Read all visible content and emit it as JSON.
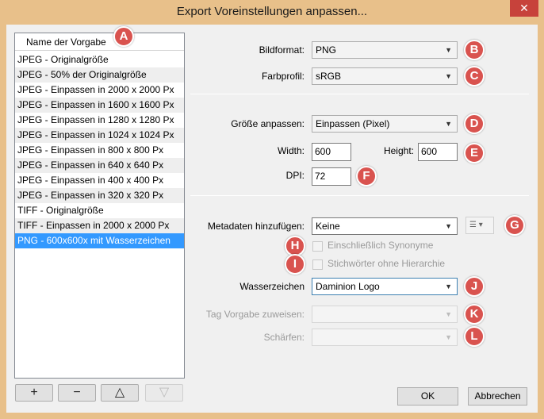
{
  "window": {
    "title": "Export Voreinstellungen anpassen...",
    "close_label": "✕",
    "accent": "#e8c08a",
    "close_color": "#c7423b"
  },
  "preset_list": {
    "header": "Name der Vorgabe",
    "items": [
      {
        "label": "JPEG - Originalgröße",
        "selected": false
      },
      {
        "label": "JPEG - 50% der Originalgröße",
        "selected": false
      },
      {
        "label": "JPEG - Einpassen in 2000 x 2000 Px",
        "selected": false
      },
      {
        "label": "JPEG - Einpassen in 1600 x 1600 Px",
        "selected": false
      },
      {
        "label": "JPEG - Einpassen in 1280 x 1280 Px",
        "selected": false
      },
      {
        "label": "JPEG - Einpassen in 1024 x 1024 Px",
        "selected": false
      },
      {
        "label": "JPEG - Einpassen in 800 x 800 Px",
        "selected": false
      },
      {
        "label": "JPEG - Einpassen in 640 x 640 Px",
        "selected": false
      },
      {
        "label": "JPEG - Einpassen in 400 x 400 Px",
        "selected": false
      },
      {
        "label": "JPEG - Einpassen in 320 x 320 Px",
        "selected": false
      },
      {
        "label": "TIFF - Originalgröße",
        "selected": false
      },
      {
        "label": "TIFF - Einpassen in 2000 x 2000 Px",
        "selected": false
      },
      {
        "label": "PNG - 600x600x mit Wasserzeichen",
        "selected": true
      }
    ],
    "selection_color": "#3399ff",
    "buttons": {
      "add": "+",
      "remove": "−",
      "up": "△",
      "down": "▽"
    }
  },
  "form": {
    "bildformat": {
      "label": "Bildformat:",
      "value": "PNG"
    },
    "farbprofil": {
      "label": "Farbprofil:",
      "value": "sRGB"
    },
    "groesse": {
      "label": "Größe anpassen:",
      "value": "Einpassen (Pixel)"
    },
    "width": {
      "label": "Width:",
      "value": "600"
    },
    "height": {
      "label": "Height:",
      "value": "600"
    },
    "dpi": {
      "label": "DPI:",
      "value": "72"
    },
    "metadaten": {
      "label": "Metadaten hinzufügen:",
      "value": "Keine"
    },
    "synonyme": {
      "label": "Einschließlich Synonyme",
      "checked": false
    },
    "hierarchie": {
      "label": "Stichwörter ohne Hierarchie",
      "checked": false
    },
    "wasserzeichen": {
      "label": "Wasserzeichen",
      "value": "Daminion Logo"
    },
    "tag_vorgabe": {
      "label": "Tag Vorgabe zuweisen:",
      "value": ""
    },
    "schaerfen": {
      "label": "Schärfen:",
      "value": ""
    }
  },
  "badges": {
    "a": "A",
    "b": "B",
    "c": "C",
    "d": "D",
    "e": "E",
    "f": "F",
    "g": "G",
    "h": "H",
    "i": "I",
    "j": "J",
    "k": "K",
    "l": "L"
  },
  "badge_color": "#d9534f",
  "footer": {
    "ok": "OK",
    "cancel": "Abbrechen"
  }
}
